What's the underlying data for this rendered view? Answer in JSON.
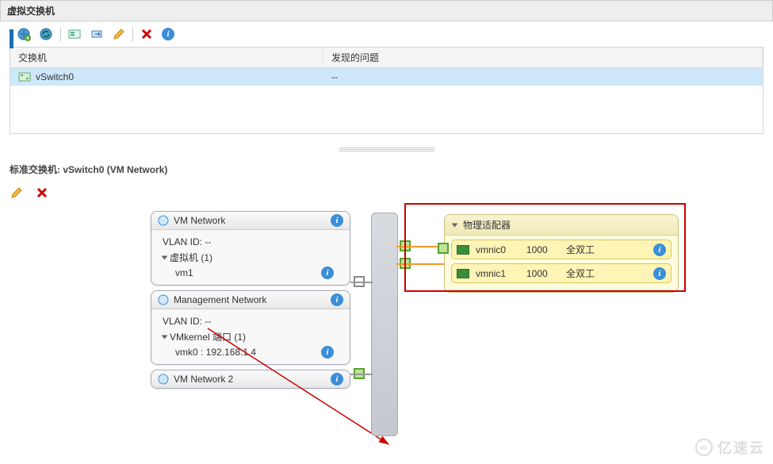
{
  "titlebar": {
    "label": "虚拟交换机"
  },
  "toolbar_icons": {
    "add_switch": "add-network-icon",
    "refresh": "refresh-icon",
    "manage": "manage-host-icon",
    "migrate": "migrate-vm-icon",
    "edit": "edit-icon",
    "remove": "remove-icon",
    "info": "info-icon"
  },
  "table": {
    "headers": {
      "switch": "交换机",
      "issues": "发现的问题"
    },
    "row": {
      "name": "vSwitch0",
      "issues": "--"
    }
  },
  "detail": {
    "title_prefix": "标准交换机:",
    "title_name": "vSwitch0 (VM Network)"
  },
  "portgroups": {
    "vm_network": {
      "title": "VM Network",
      "vlan_label": "VLAN ID: --",
      "vm_group": "虚拟机 (1)",
      "vm1": "vm1"
    },
    "management": {
      "title": "Management Network",
      "vlan_label": "VLAN ID: --",
      "vmk_group": "VMkernel 端口 (1)",
      "vmk0": "vmk0 : 192.168.1.4"
    },
    "vm_network2": {
      "title": "VM Network 2"
    }
  },
  "physical": {
    "title": "物理适配器",
    "nics": [
      {
        "name": "vmnic0",
        "speed": "1000",
        "duplex": "全双工"
      },
      {
        "name": "vmnic1",
        "speed": "1000",
        "duplex": "全双工"
      }
    ]
  },
  "watermark": "亿速云"
}
